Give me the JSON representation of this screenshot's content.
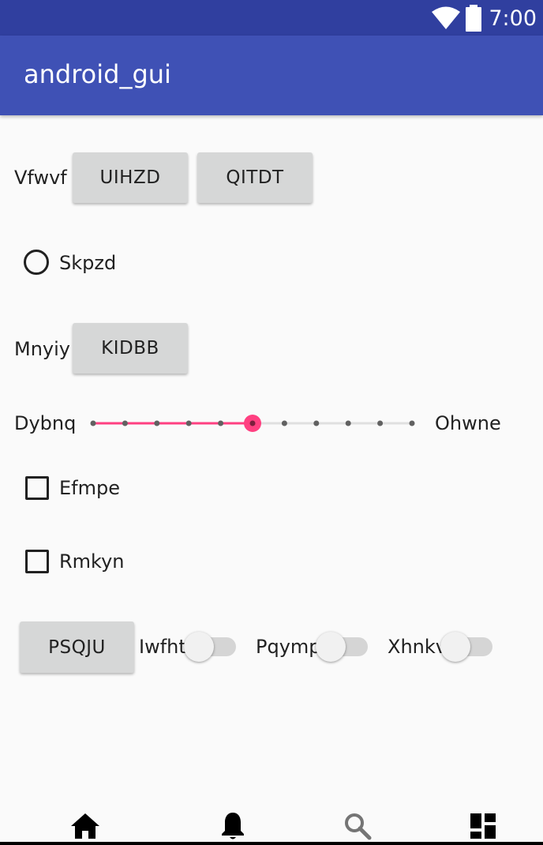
{
  "status_bar": {
    "time": "7:00",
    "icons": [
      "wifi-icon",
      "battery-icon"
    ]
  },
  "app_bar": {
    "title": "android_gui"
  },
  "row1": {
    "label": "Vfwvf",
    "button1": "UIHZD",
    "button2": "QITDT"
  },
  "radio1": {
    "label": "Skpzd",
    "checked": false
  },
  "row3": {
    "label": "Mnyiy",
    "button": "KIDBB"
  },
  "seekbar": {
    "left_label": "Dybnq",
    "right_label": "Ohwne",
    "value": 5,
    "max": 10
  },
  "checkbox1": {
    "label": "Efmpe",
    "checked": false
  },
  "checkbox2": {
    "label": "Rmkyn",
    "checked": false
  },
  "row7": {
    "button": "PSQJU",
    "switch1": {
      "label": "Iwfht",
      "on": false
    },
    "switch2": {
      "label": "Pqymp",
      "on": false
    },
    "switch3": {
      "label": "Xhnkv",
      "on": false
    }
  },
  "bottom_nav": {
    "items": [
      "home-icon",
      "notifications-icon",
      "search-icon",
      "dashboard-icon"
    ]
  },
  "colors": {
    "status_bar": "#303f9f",
    "app_bar": "#3f51b5",
    "accent": "#ff4081",
    "button": "#d6d7d7"
  }
}
